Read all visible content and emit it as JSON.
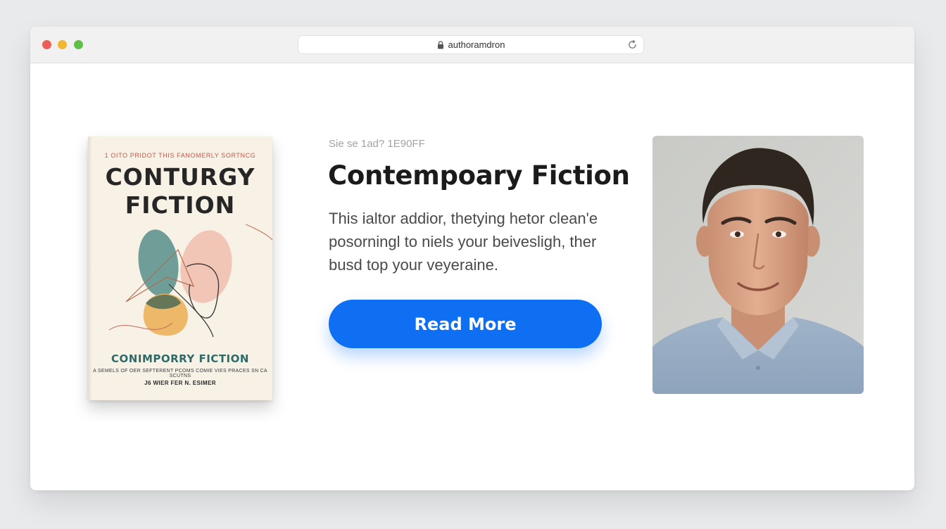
{
  "browser": {
    "url": "authoramdron"
  },
  "book": {
    "top_line": "1 OITO PRIDOT  THIS FANOMERLY SORTNCG",
    "title_line1": "CONTURGY",
    "title_line2": "FICTION",
    "subtitle": "CONIMPORRY FICTION",
    "tagline": "A SEMELS OF OER SEFTERENT PCOMS  COMIE VIES PRACES SN CA SCUTNS",
    "author": "J6 WIER FER N. ESIMER"
  },
  "hero": {
    "eyebrow": "Sie se 1ad?  1E90FF",
    "title": "Contempoary Fiction",
    "body_lines": [
      "This ialtor addior, thetying hetor clean'e",
      "posorningl to niels your beivesligh, ther",
      "busd top your veyeraine."
    ],
    "cta_label": "Read More"
  },
  "colors": {
    "accent": "#0F6FF3",
    "book_cover": "#F7F1E6",
    "book_subtitle": "#2E6A68"
  }
}
